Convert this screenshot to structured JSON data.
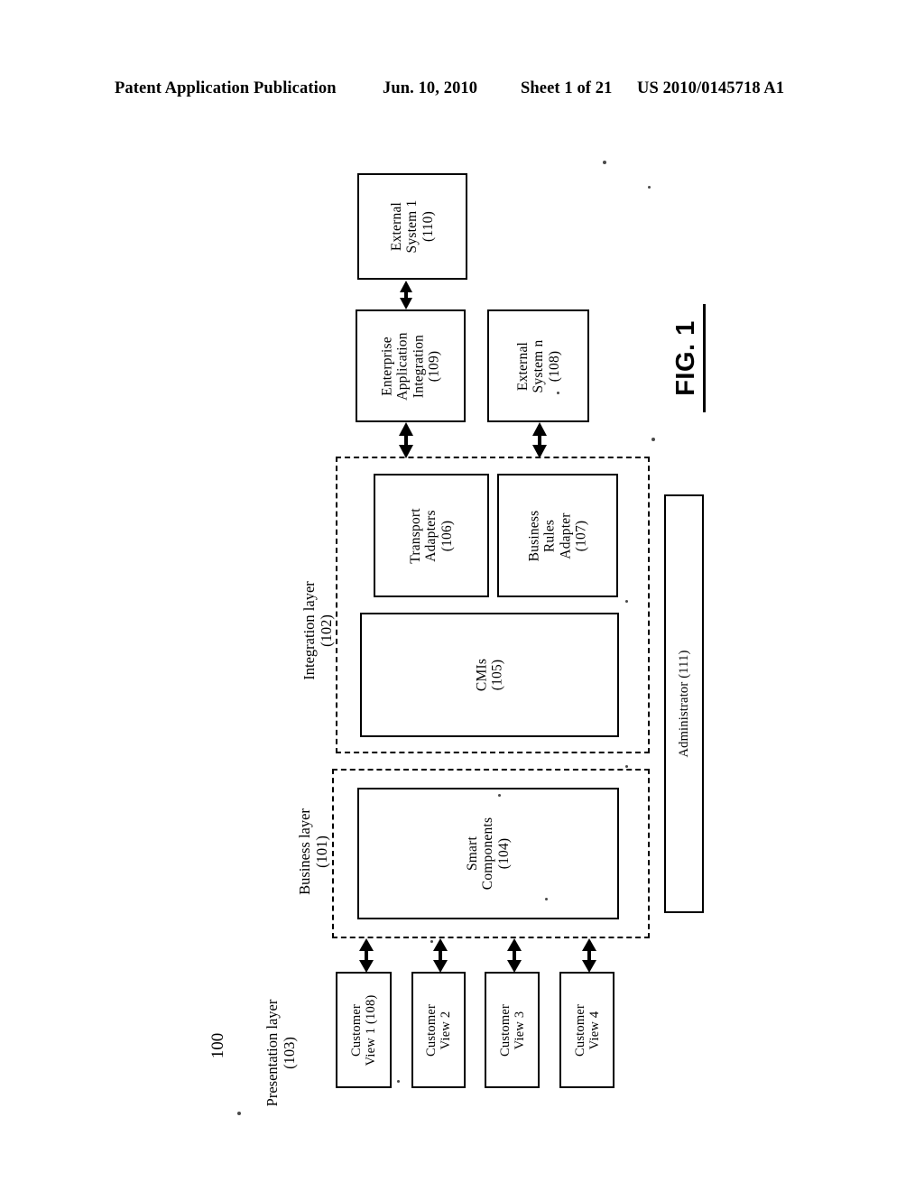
{
  "header": {
    "publication": "Patent Application Publication",
    "date": "Jun. 10, 2010",
    "sheet": "Sheet 1 of 21",
    "patent_number": "US 2010/0145718 A1"
  },
  "figure": {
    "label": "FIG. 1",
    "reference_numeral": "100",
    "layers": [
      {
        "id": "presentation",
        "label": "Presentation layer",
        "ref": "(103)"
      },
      {
        "id": "business",
        "label": "Business layer",
        "ref": "(101)"
      },
      {
        "id": "integration",
        "label": "Integration layer",
        "ref": "(102)"
      }
    ],
    "blocks": {
      "external_system_1": {
        "line1": "External",
        "line2": "System 1",
        "ref": "(110)"
      },
      "enterprise_application_integration": {
        "line1": "Enterprise",
        "line2": "Application",
        "line3": "Integration",
        "ref": "(109)"
      },
      "external_system_n": {
        "line1": "External",
        "line2": "System n",
        "ref": "(108)"
      },
      "transport_adapters": {
        "line1": "Transport",
        "line2": "Adapters",
        "ref": "(106)"
      },
      "business_rules_adapter": {
        "line1": "Business",
        "line2": "Rules",
        "line3": "Adapter",
        "ref": "(107)"
      },
      "cmis": {
        "line1": "CMIs",
        "ref": "(105)"
      },
      "smart_components": {
        "line1": "Smart",
        "line2": "Components",
        "ref": "(104)"
      },
      "administrator": {
        "line1": "Administrator (111)"
      },
      "customer_view_1": {
        "line1": "Customer",
        "line2": "View 1 (108)"
      },
      "customer_view_2": {
        "line1": "Customer",
        "line2": "View 2"
      },
      "customer_view_3": {
        "line1": "Customer",
        "line2": "View 3"
      },
      "customer_view_4": {
        "line1": "Customer",
        "line2": "View 4"
      }
    },
    "connectors": [
      {
        "id": "es1-eai",
        "type": "double-headed-arrow",
        "from": "external_system_1",
        "to": "enterprise_application_integration"
      },
      {
        "id": "eai-integration",
        "type": "double-headed-arrow",
        "from": "enterprise_application_integration",
        "to": "integration_layer"
      },
      {
        "id": "esn-integration",
        "type": "double-headed-arrow",
        "from": "external_system_n",
        "to": "integration_layer"
      },
      {
        "id": "cv1-business",
        "type": "double-headed-arrow",
        "from": "customer_view_1",
        "to": "business_layer"
      },
      {
        "id": "cv2-business",
        "type": "double-headed-arrow",
        "from": "customer_view_2",
        "to": "business_layer"
      },
      {
        "id": "cv3-business",
        "type": "double-headed-arrow",
        "from": "customer_view_3",
        "to": "business_layer"
      },
      {
        "id": "cv4-business",
        "type": "double-headed-arrow",
        "from": "customer_view_4",
        "to": "business_layer"
      }
    ]
  }
}
